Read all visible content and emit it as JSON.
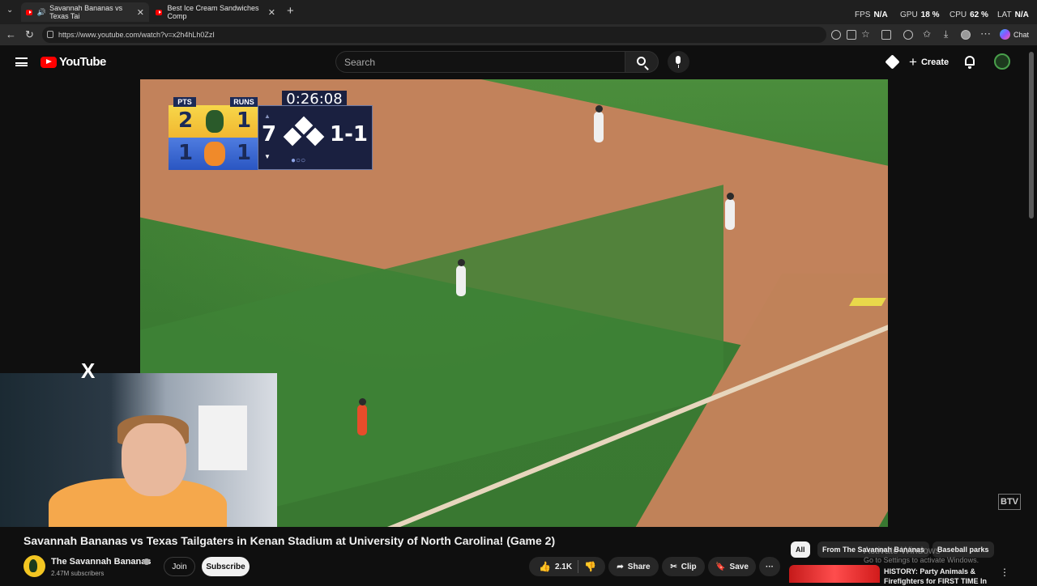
{
  "browser": {
    "tabs": [
      {
        "label": "Savannah Bananas vs Texas Tai",
        "active": true
      },
      {
        "label": "Best Ice Cream Sandwiches Comp",
        "active": false
      }
    ],
    "new_tab_glyph": "+",
    "tab_close_glyph": "✕",
    "url": "https://www.youtube.com/watch?v=x2h4hLh0ZzI",
    "chat_label": "Chat",
    "perf": {
      "fps_label": "FPS",
      "fps_value": "N/A",
      "gpu_label": "GPU",
      "gpu_value": "18 %",
      "cpu_label": "CPU",
      "cpu_value": "62 %",
      "lat_label": "LAT",
      "lat_value": "N/A"
    }
  },
  "youtube": {
    "logo_text": "YouTube",
    "search_placeholder": "Search",
    "create_label": "Create"
  },
  "video": {
    "scoreboard": {
      "pts_header": "PTS",
      "runs_header": "RUNS",
      "clock": "0:26:08",
      "team1_pts": "2",
      "team1_runs": "1",
      "team2_pts": "1",
      "team2_runs": "1",
      "inning": "7",
      "count": "1-1"
    },
    "watermark": "BTV",
    "title": "Savannah Bananas vs Texas Tailgaters in Kenan Stadium at University of North Carolina! (Game 2)",
    "channel_name": "The Savannah Bananas",
    "subscribers": "2.47M subscribers",
    "join_label": "Join",
    "subscribe_label": "Subscribe",
    "like_count": "2.1K",
    "share_label": "Share",
    "clip_label": "Clip",
    "save_label": "Save",
    "more_glyph": "···"
  },
  "sidebar": {
    "chips": [
      "All",
      "From The Savannah Bananas",
      "Baseball parks"
    ],
    "recommendation_title": "HISTORY: Party Animals & Firefighters for FIRST TIME In",
    "activate_line1": "Activate Windows",
    "activate_line2": "Go to Settings to activate Windows."
  }
}
